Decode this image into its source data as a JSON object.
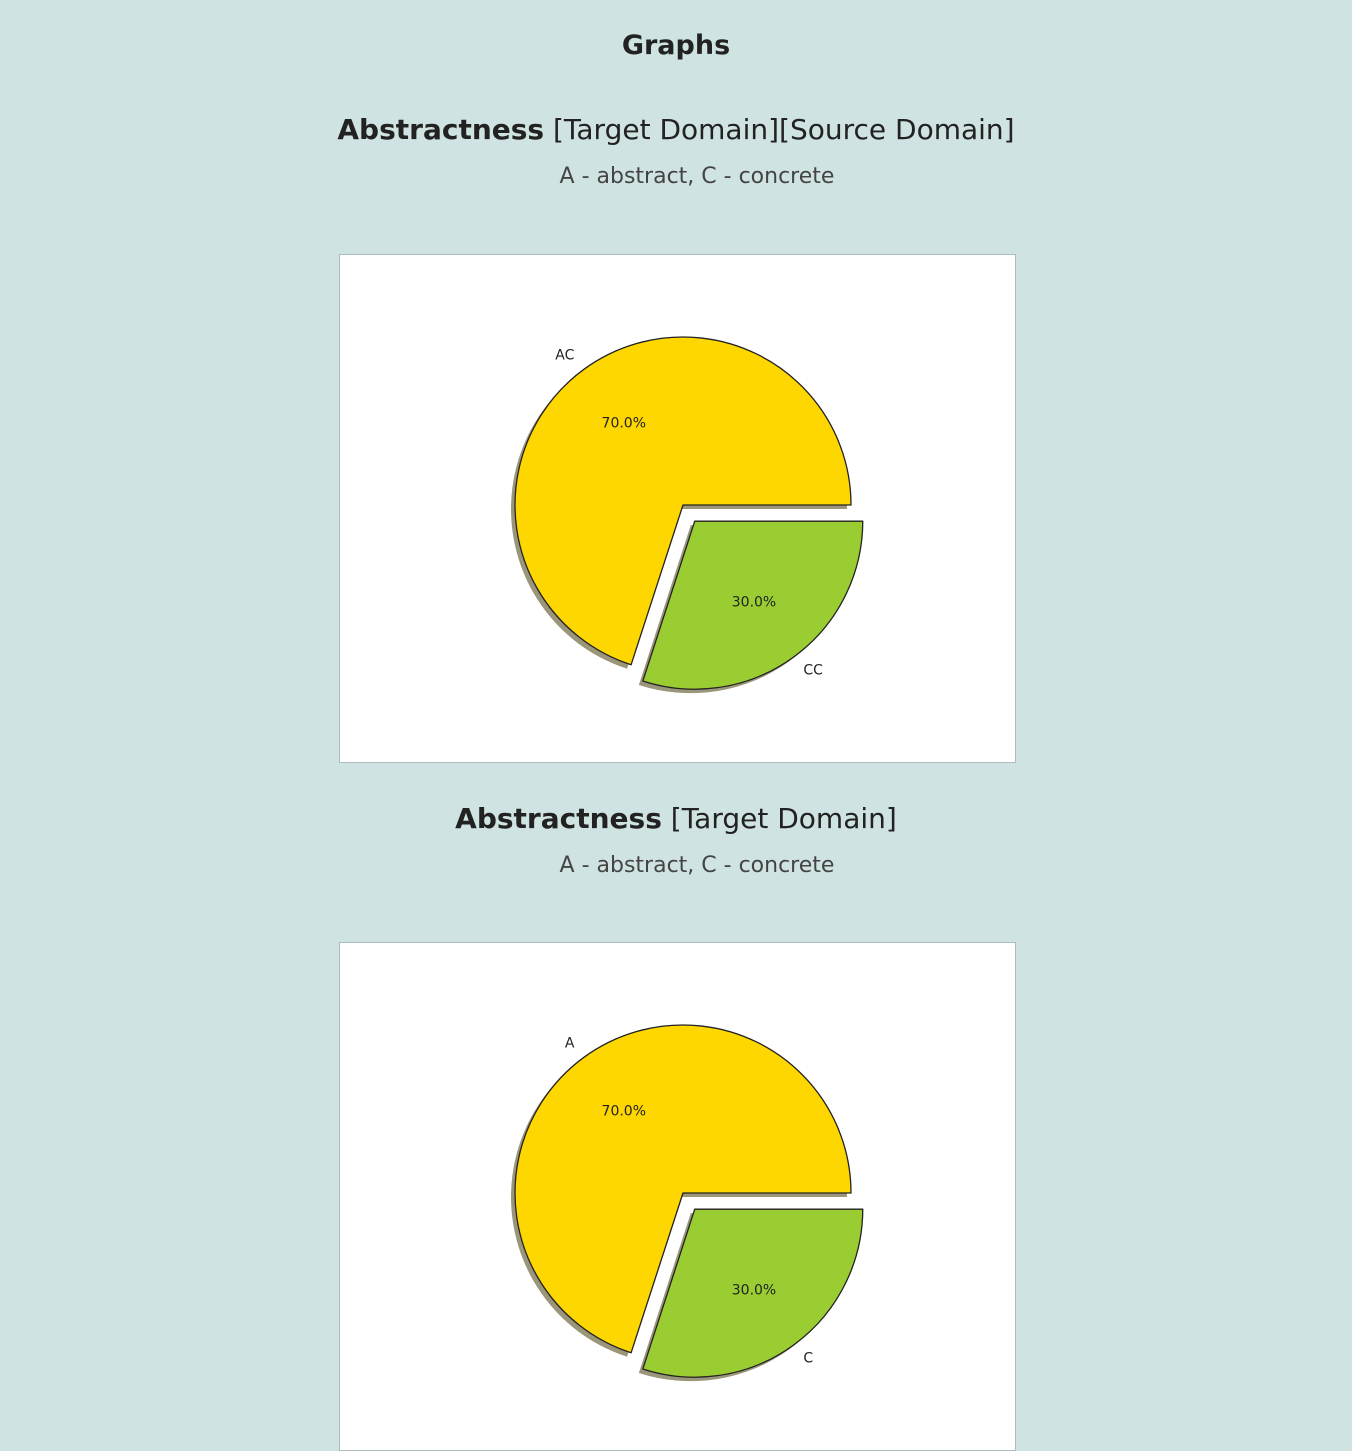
{
  "page": {
    "title": "Graphs"
  },
  "sections": [
    {
      "heading_bold": "Abstractness",
      "heading_rest": " [Target Domain][Source Domain]",
      "subtitle": "A - abstract, C - concrete"
    },
    {
      "heading_bold": "Abstractness",
      "heading_rest": " [Target Domain]",
      "subtitle": "A - abstract, C - concrete"
    }
  ],
  "chart_data": [
    {
      "type": "pie",
      "labels": [
        "AC",
        "CC"
      ],
      "values": [
        70.0,
        30.0
      ],
      "percent_labels": [
        "70.0%",
        "30.0%"
      ],
      "colors": [
        "#ffd700",
        "#9acd32"
      ],
      "explode": [
        0,
        1
      ],
      "shadow": true
    },
    {
      "type": "pie",
      "labels": [
        "A",
        "C"
      ],
      "values": [
        70.0,
        30.0
      ],
      "percent_labels": [
        "70.0%",
        "30.0%"
      ],
      "colors": [
        "#ffd700",
        "#9acd32"
      ],
      "explode": [
        0,
        1
      ],
      "shadow": true
    }
  ]
}
